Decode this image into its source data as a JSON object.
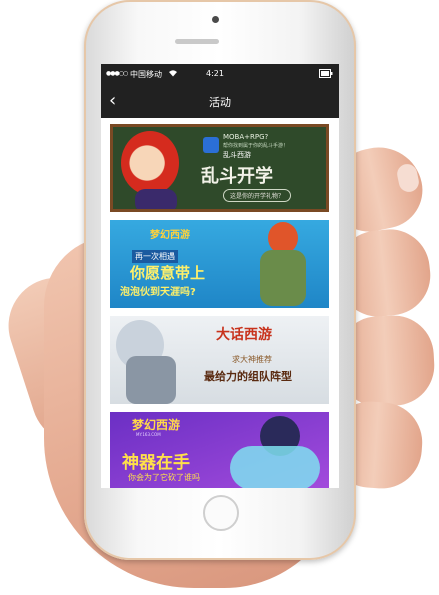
{
  "status_bar": {
    "signal": "●●●○○",
    "carrier": "中国移动",
    "time": "4:21"
  },
  "nav": {
    "back_icon": "chevron-left-icon",
    "back_glyph": "‹",
    "title": "活动"
  },
  "banners": [
    {
      "title": "乱斗开学",
      "brand": "MOBA+RPG?",
      "tagline": "帮你找到属于你的乱斗手游！",
      "game": "乱斗西游",
      "subtitle": "这是你的开学礼物？"
    },
    {
      "logo": "梦幻西游",
      "line1": "再一次相遇",
      "line2": "你愿意带上",
      "line3": "泡泡伙到天涯吗?"
    },
    {
      "logo": "大话西游",
      "line1": "求大神推荐",
      "line2": "最给力的组队阵型"
    },
    {
      "logo": "梦幻西游",
      "site": "MY.163.COM",
      "line1": "神器在手",
      "line2": "你会为了它砍了谁吗"
    }
  ],
  "colors": {
    "bar": "#212121",
    "banner1_bg": "#2f4a2a",
    "banner2_bg": "#36a9e0",
    "banner3_bg": "#e6eaee",
    "banner4_bg": "#7c35cc"
  }
}
